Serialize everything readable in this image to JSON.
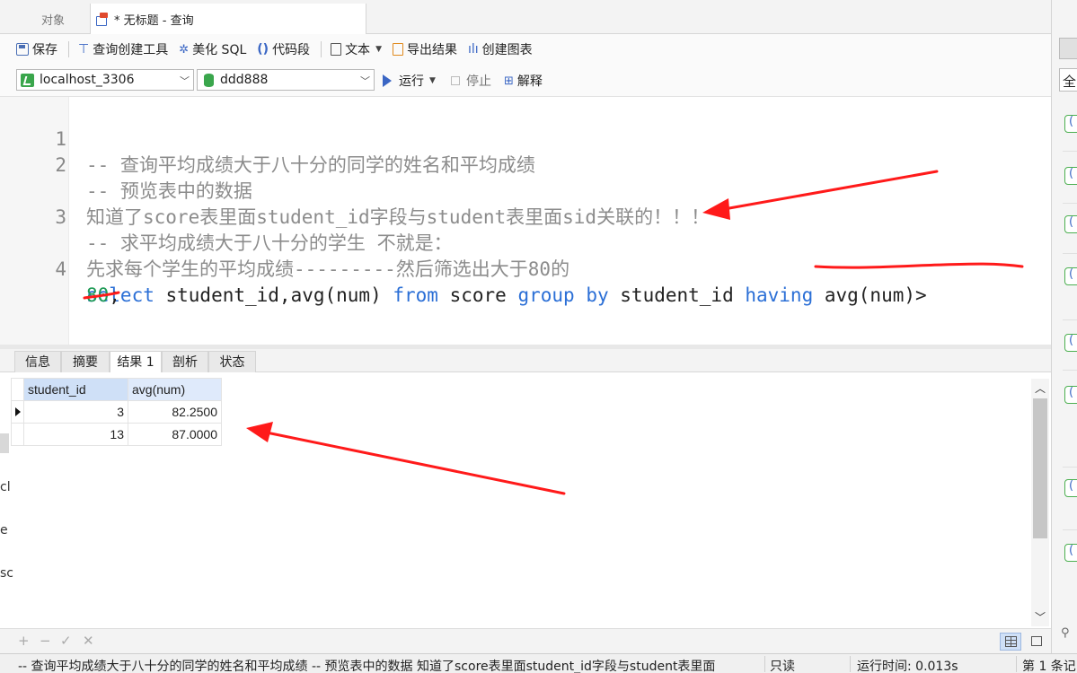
{
  "tabs": {
    "objects": "对象",
    "query": "* 无标题 - 查询"
  },
  "toolbar": {
    "save": "保存",
    "query_builder": "查询创建工具",
    "beautify_sql": "美化 SQL",
    "code_snippet": "代码段",
    "text": "文本",
    "export_result": "导出结果",
    "create_chart": "创建图表"
  },
  "connection": {
    "server": "localhost_3306",
    "database": "ddd888",
    "run": "运行",
    "stop": "停止",
    "explain": "解释"
  },
  "editor": {
    "lines": [
      {
        "num": "1",
        "text": "-- 查询平均成绩大于八十分的同学的姓名和平均成绩"
      },
      {
        "num": "2",
        "text": "-- 预览表中的数据"
      },
      {
        "num": "",
        "text": "知道了score表里面student_id字段与student表里面sid关联的！！！"
      },
      {
        "num": "3",
        "text": "-- 求平均成绩大于八十分的学生 不就是："
      },
      {
        "num": "",
        "text": "先求每个学生的平均成绩---------然后筛选出大于80的"
      }
    ],
    "sql_line_num": "4",
    "sql_tokens": {
      "select": "select",
      "cols": " student_id,avg(num) ",
      "from": "from",
      "table": " score ",
      "group": "group",
      "sp1": " ",
      "by": "by",
      "gcol": " student_id ",
      "having": "having",
      "cond": " avg(num)>"
    },
    "sql_wrap_num": "80",
    "sql_wrap_end": ";"
  },
  "result_tabs": [
    "信息",
    "摘要",
    "结果 1",
    "剖析",
    "状态"
  ],
  "result_grid": {
    "columns": [
      "student_id",
      "avg(num)"
    ],
    "rows": [
      [
        "3",
        "82.2500"
      ],
      [
        "13",
        "87.0000"
      ]
    ]
  },
  "grid_toolbar": {
    "add": "+",
    "remove": "−",
    "apply": "✓",
    "discard": "✕"
  },
  "status": {
    "sql_text": "-- 查询平均成绩大于八十分的同学的姓名和平均成绩 -- 预览表中的数据  知道了score表里面student_id字段与student表里面",
    "readonly": "只读",
    "runtime": "运行时间: 0.013s",
    "record": "第 1 条记"
  },
  "right_panel": {
    "all_label": "全"
  },
  "left_edge": {
    "t1": "cl",
    "t2": "e",
    "t3": "sc"
  },
  "colors": {
    "keyword": "#2b6fd6",
    "comment": "#8c8c8c",
    "number": "#1e9a55",
    "annotation": "#ff1a1a"
  }
}
